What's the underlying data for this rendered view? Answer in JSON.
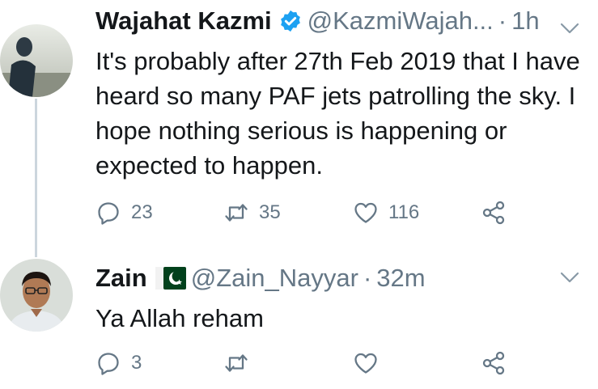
{
  "colors": {
    "text": "#14171a",
    "secondary": "#657786",
    "verified": "#1da1f2",
    "thread_line": "#ccd6dd",
    "flag_green": "#01411c"
  },
  "tweets": [
    {
      "name": "Wajahat Kazmi",
      "verified": true,
      "handle": "@KazmiWajah...",
      "separator": "·",
      "time": "1h",
      "text": "It's probably after 27th Feb 2019 that I have heard so many PAF jets patrolling the sky. I hope nothing serious is happening or expected to happen.",
      "actions": {
        "reply": "23",
        "retweet": "35",
        "like": "116"
      },
      "icons": [
        "verified-badge-icon",
        "chevron-down-icon",
        "reply-icon",
        "retweet-icon",
        "like-icon",
        "share-icon"
      ]
    },
    {
      "name": "Zain",
      "flag_emoji": "pakistan-flag",
      "handle": "@Zain_Nayyar",
      "separator": "·",
      "time": "32m",
      "text": "Ya Allah reham",
      "actions": {
        "reply": "3",
        "retweet": "",
        "like": ""
      },
      "icons": [
        "pakistan-flag-icon",
        "chevron-down-icon",
        "reply-icon",
        "retweet-icon",
        "like-icon",
        "share-icon"
      ]
    }
  ]
}
